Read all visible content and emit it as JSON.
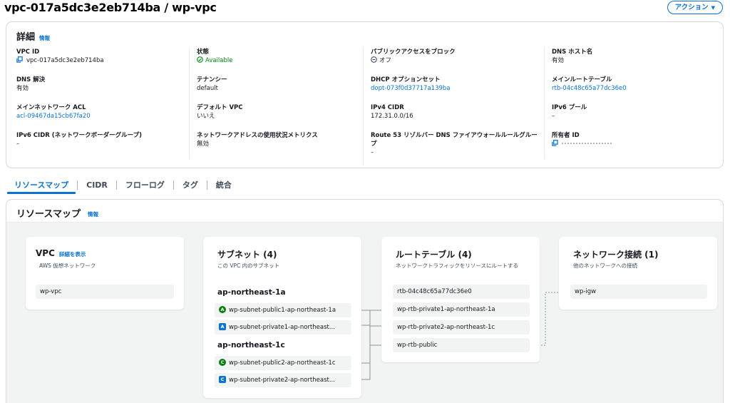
{
  "header": {
    "title": "vpc-017a5dc3e2eb714ba / wp-vpc",
    "action_label": "アクション"
  },
  "details": {
    "heading": "詳細",
    "info": "情報",
    "columns": [
      [
        {
          "label": "VPC ID",
          "value": "vpc-017a5dc3e2eb714ba"
        },
        {
          "label": "DNS 解決",
          "value": "有効"
        },
        {
          "label": "メインネットワーク ACL",
          "value": "acl-09467da15cb67fa20"
        },
        {
          "label": "IPv6 CIDR (ネットワークボーダーグループ)",
          "value": "–"
        }
      ],
      [
        {
          "label": "状態",
          "value": "Available"
        },
        {
          "label": "テナンシー",
          "value": "default"
        },
        {
          "label": "デフォルト VPC",
          "value": "いいえ"
        },
        {
          "label": "ネットワークアドレスの使用状況メトリクス",
          "value": "無効"
        }
      ],
      [
        {
          "label": "パブリックアクセスをブロック",
          "value": "オフ"
        },
        {
          "label": "DHCP オプションセット",
          "value": "dopt-073f0d37717a139ba"
        },
        {
          "label": "IPv4 CIDR",
          "value": "172.31.0.0/16"
        },
        {
          "label": "Route 53 リゾルバー DNS ファイアウォールルールグループ",
          "value": "–"
        }
      ],
      [
        {
          "label": "DNS ホスト名",
          "value": "有効"
        },
        {
          "label": "メインルートテーブル",
          "value": "rtb-04c48c65a77dc36e0"
        },
        {
          "label": "IPv6 プール",
          "value": "–"
        },
        {
          "label": "所有者 ID",
          "value": ""
        }
      ]
    ]
  },
  "tabs": [
    "リソースマップ",
    "CIDR",
    "フローログ",
    "タグ",
    "統合"
  ],
  "resource_map": {
    "heading": "リソースマップ",
    "info": "情報",
    "vpc_card": {
      "title": "VPC",
      "link": "詳細を表示",
      "sub": "AWS 仮想ネットワーク",
      "item": "wp-vpc"
    },
    "subnet_card": {
      "title": "サブネット (4)",
      "sub": "この VPC 内のサブネット",
      "groups": [
        {
          "az": "ap-northeast-1a",
          "items": [
            {
              "badge": "A",
              "kind": "pub",
              "name": "wp-subnet-public1-ap-northeast-1a"
            },
            {
              "badge": "A",
              "kind": "priv",
              "name": "wp-subnet-private1-ap-northeast..."
            }
          ]
        },
        {
          "az": "ap-northeast-1c",
          "items": [
            {
              "badge": "C",
              "kind": "pub",
              "name": "wp-subnet-public2-ap-northeast-1c"
            },
            {
              "badge": "C",
              "kind": "priv",
              "name": "wp-subnet-private2-ap-northeast..."
            }
          ]
        }
      ]
    },
    "route_card": {
      "title": "ルートテーブル (4)",
      "sub": "ネットワークトラフィックをリソースにルートする",
      "items": [
        "rtb-04c48c65a77dc36e0",
        "wp-rtb-private1-ap-northeast-1a",
        "wp-rtb-private2-ap-northeast-1c",
        "wp-rtb-public"
      ]
    },
    "network_card": {
      "title": "ネットワーク接続 (1)",
      "sub": "他のネットワークへの接続",
      "item": "wp-igw"
    }
  },
  "colors": {
    "link": "#0972d3",
    "available": "#037f0c"
  }
}
